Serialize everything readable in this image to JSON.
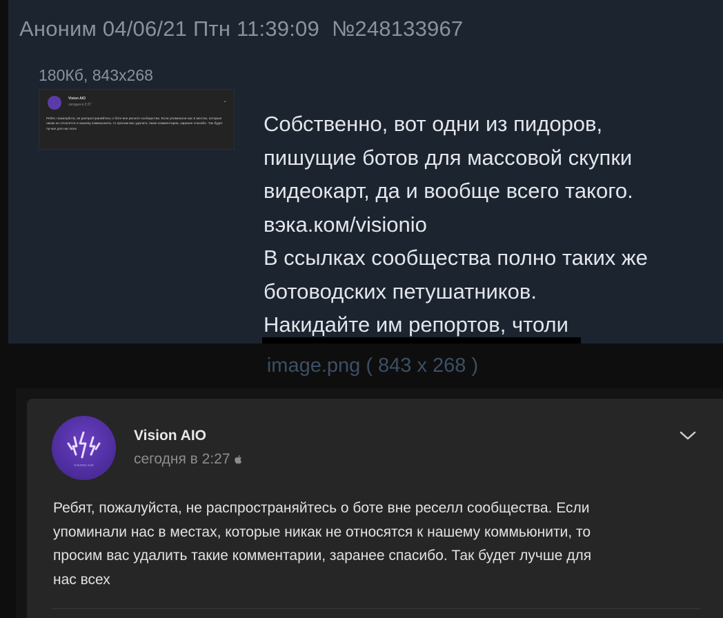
{
  "post": {
    "author": "Аноним",
    "date": "04/06/21",
    "weekday": "Птн",
    "time": "11:39:09",
    "number": "№248133967",
    "file_info": "180Кб, 843x268",
    "body_lines": [
      "Собственно, вот одни из пидоров,",
      "пишущие ботов для массовой скупки",
      "видеокарт, да и вообще всего такого.",
      "вэка.ком/visionio",
      "В ссылках сообщества полно таких же",
      "ботоводских петушатников.",
      "Накидайте им репортов, чтоли"
    ]
  },
  "viewer": {
    "caption": "image.png ( 843 x 268 )"
  },
  "card": {
    "author": "Vision AIO",
    "time": "сегодня в 2:27",
    "avatar_text": "VISION AIO",
    "text_lines": [
      "Ребят, пожалуйста, не распространяйтесь о боте вне реселл сообщества. Если",
      "упоминали нас в местах, которые никак не относятся к нашему коммьюнити, то",
      "просим вас удалить такие комментарии, заранее спасибо. Так будет лучше для",
      "нас всех"
    ]
  },
  "colors": {
    "post_background": "#1c2430",
    "post_meta": "#8a939d",
    "caption": "#3c4f66",
    "card_background": "#262626",
    "avatar_purple": "#5a3ca8"
  },
  "icons": [
    "apple-icon",
    "chevron-down-icon",
    "lightning-logo-icon"
  ]
}
